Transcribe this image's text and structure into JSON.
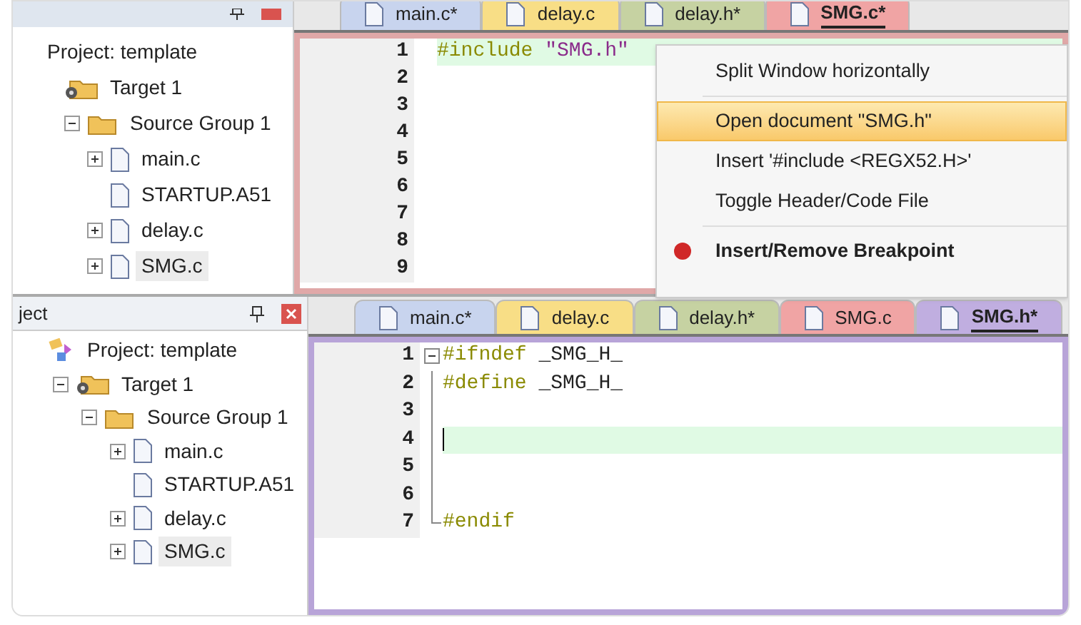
{
  "top_view": {
    "project_panel": {
      "tree": [
        {
          "label": "Project: template",
          "selected": false,
          "children": [
            {
              "label": "Target 1",
              "kind": "target",
              "selected": false,
              "children": [
                {
                  "label": "Source Group 1",
                  "kind": "folder",
                  "expanded": true,
                  "selected": false,
                  "children": [
                    {
                      "label": "main.c",
                      "kind": "file",
                      "expanded": false,
                      "selected": false
                    },
                    {
                      "label": "STARTUP.A51",
                      "kind": "file",
                      "selected": false
                    },
                    {
                      "label": "delay.c",
                      "kind": "file",
                      "expanded": false,
                      "selected": false
                    },
                    {
                      "label": "SMG.c",
                      "kind": "file",
                      "expanded": false,
                      "selected": true
                    }
                  ]
                }
              ]
            }
          ]
        }
      ]
    },
    "tabs": [
      {
        "label": "main.c*",
        "color": "#c8d4ee",
        "selected": false
      },
      {
        "label": "delay.c",
        "color": "#f8de86",
        "selected": false
      },
      {
        "label": "delay.h*",
        "color": "#c6d2a2",
        "selected": false
      },
      {
        "label": "SMG.c*",
        "color": "#f0a4a4",
        "selected": true
      }
    ],
    "editor": {
      "lines": [
        {
          "number": "1",
          "highlighted": true,
          "tokens": [
            {
              "text": "#include ",
              "kind": "directive"
            },
            {
              "text": "\"SMG.h\"",
              "kind": "string"
            }
          ]
        },
        {
          "number": "2",
          "highlighted": false
        },
        {
          "number": "3",
          "highlighted": false
        },
        {
          "number": "4",
          "highlighted": false
        },
        {
          "number": "5",
          "highlighted": false
        },
        {
          "number": "6",
          "highlighted": false
        },
        {
          "number": "7",
          "highlighted": false
        },
        {
          "number": "8",
          "highlighted": false
        },
        {
          "number": "9",
          "highlighted": false
        }
      ]
    },
    "context_menu": {
      "items": [
        {
          "kind": "item",
          "label": "Split Window horizontally",
          "selected": false
        },
        {
          "kind": "separator"
        },
        {
          "kind": "item",
          "label": "Open document \"SMG.h\"",
          "selected": true
        },
        {
          "kind": "item",
          "label": "Insert '#include <REGX52.H>'",
          "selected": false
        },
        {
          "kind": "item",
          "label": "Toggle Header/Code File",
          "selected": false
        },
        {
          "kind": "separator"
        },
        {
          "kind": "breakpoint",
          "label": "Insert/Remove Breakpoint",
          "selected": false
        }
      ]
    }
  },
  "bottom_view": {
    "project_panel": {
      "title": "ject",
      "tree": [
        {
          "label": "Project: template",
          "kind": "project",
          "selected": false,
          "children": [
            {
              "label": "Target 1",
              "kind": "target",
              "expanded": true,
              "selected": false,
              "children": [
                {
                  "label": "Source Group 1",
                  "kind": "folder",
                  "expanded": true,
                  "selected": false,
                  "children": [
                    {
                      "label": "main.c",
                      "kind": "file",
                      "expanded": false,
                      "selected": false
                    },
                    {
                      "label": "STARTUP.A51",
                      "kind": "file",
                      "selected": false
                    },
                    {
                      "label": "delay.c",
                      "kind": "file",
                      "expanded": false,
                      "selected": false
                    },
                    {
                      "label": "SMG.c",
                      "kind": "file",
                      "expanded": false,
                      "selected": true
                    }
                  ]
                }
              ]
            }
          ]
        }
      ]
    },
    "tabs": [
      {
        "label": "main.c*",
        "color": "#c8d4ee",
        "selected": false
      },
      {
        "label": "delay.c",
        "color": "#f8de86",
        "selected": false
      },
      {
        "label": "delay.h*",
        "color": "#c6d2a2",
        "selected": false
      },
      {
        "label": "SMG.c",
        "color": "#f0a4a4",
        "selected": false
      },
      {
        "label": "SMG.h*",
        "color": "#c0aee0",
        "selected": true
      }
    ],
    "editor": {
      "lines": [
        {
          "number": "1",
          "highlighted": false,
          "kind": "fold_start",
          "tokens": [
            {
              "text": "#ifndef",
              "kind": "directive"
            },
            {
              "text": " _SMG_H_",
              "kind": "plain"
            }
          ]
        },
        {
          "number": "2",
          "highlighted": false,
          "kind": "fold_body",
          "tokens": [
            {
              "text": "#define",
              "kind": "directive"
            },
            {
              "text": " _SMG_H_",
              "kind": "plain"
            }
          ]
        },
        {
          "number": "3",
          "highlighted": false,
          "kind": "fold_body"
        },
        {
          "number": "4",
          "highlighted": true,
          "cursor": true,
          "kind": "fold_body"
        },
        {
          "number": "5",
          "highlighted": false,
          "kind": "fold_body"
        },
        {
          "number": "6",
          "highlighted": false,
          "kind": "fold_body"
        },
        {
          "number": "7",
          "highlighted": false,
          "kind": "fold_end",
          "tokens": [
            {
              "text": "#endif",
              "kind": "directive"
            }
          ]
        }
      ]
    }
  }
}
